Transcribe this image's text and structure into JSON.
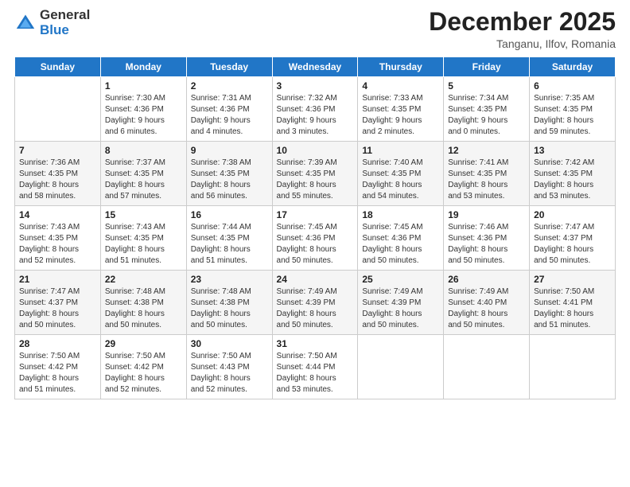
{
  "logo": {
    "general": "General",
    "blue": "Blue"
  },
  "header": {
    "month": "December 2025",
    "location": "Tanganu, Ilfov, Romania"
  },
  "days_of_week": [
    "Sunday",
    "Monday",
    "Tuesday",
    "Wednesday",
    "Thursday",
    "Friday",
    "Saturday"
  ],
  "weeks": [
    [
      {
        "day": "",
        "info": ""
      },
      {
        "day": "1",
        "info": "Sunrise: 7:30 AM\nSunset: 4:36 PM\nDaylight: 9 hours\nand 6 minutes."
      },
      {
        "day": "2",
        "info": "Sunrise: 7:31 AM\nSunset: 4:36 PM\nDaylight: 9 hours\nand 4 minutes."
      },
      {
        "day": "3",
        "info": "Sunrise: 7:32 AM\nSunset: 4:36 PM\nDaylight: 9 hours\nand 3 minutes."
      },
      {
        "day": "4",
        "info": "Sunrise: 7:33 AM\nSunset: 4:35 PM\nDaylight: 9 hours\nand 2 minutes."
      },
      {
        "day": "5",
        "info": "Sunrise: 7:34 AM\nSunset: 4:35 PM\nDaylight: 9 hours\nand 0 minutes."
      },
      {
        "day": "6",
        "info": "Sunrise: 7:35 AM\nSunset: 4:35 PM\nDaylight: 8 hours\nand 59 minutes."
      }
    ],
    [
      {
        "day": "7",
        "info": "Sunrise: 7:36 AM\nSunset: 4:35 PM\nDaylight: 8 hours\nand 58 minutes."
      },
      {
        "day": "8",
        "info": "Sunrise: 7:37 AM\nSunset: 4:35 PM\nDaylight: 8 hours\nand 57 minutes."
      },
      {
        "day": "9",
        "info": "Sunrise: 7:38 AM\nSunset: 4:35 PM\nDaylight: 8 hours\nand 56 minutes."
      },
      {
        "day": "10",
        "info": "Sunrise: 7:39 AM\nSunset: 4:35 PM\nDaylight: 8 hours\nand 55 minutes."
      },
      {
        "day": "11",
        "info": "Sunrise: 7:40 AM\nSunset: 4:35 PM\nDaylight: 8 hours\nand 54 minutes."
      },
      {
        "day": "12",
        "info": "Sunrise: 7:41 AM\nSunset: 4:35 PM\nDaylight: 8 hours\nand 53 minutes."
      },
      {
        "day": "13",
        "info": "Sunrise: 7:42 AM\nSunset: 4:35 PM\nDaylight: 8 hours\nand 53 minutes."
      }
    ],
    [
      {
        "day": "14",
        "info": "Sunrise: 7:43 AM\nSunset: 4:35 PM\nDaylight: 8 hours\nand 52 minutes."
      },
      {
        "day": "15",
        "info": "Sunrise: 7:43 AM\nSunset: 4:35 PM\nDaylight: 8 hours\nand 51 minutes."
      },
      {
        "day": "16",
        "info": "Sunrise: 7:44 AM\nSunset: 4:35 PM\nDaylight: 8 hours\nand 51 minutes."
      },
      {
        "day": "17",
        "info": "Sunrise: 7:45 AM\nSunset: 4:36 PM\nDaylight: 8 hours\nand 50 minutes."
      },
      {
        "day": "18",
        "info": "Sunrise: 7:45 AM\nSunset: 4:36 PM\nDaylight: 8 hours\nand 50 minutes."
      },
      {
        "day": "19",
        "info": "Sunrise: 7:46 AM\nSunset: 4:36 PM\nDaylight: 8 hours\nand 50 minutes."
      },
      {
        "day": "20",
        "info": "Sunrise: 7:47 AM\nSunset: 4:37 PM\nDaylight: 8 hours\nand 50 minutes."
      }
    ],
    [
      {
        "day": "21",
        "info": "Sunrise: 7:47 AM\nSunset: 4:37 PM\nDaylight: 8 hours\nand 50 minutes."
      },
      {
        "day": "22",
        "info": "Sunrise: 7:48 AM\nSunset: 4:38 PM\nDaylight: 8 hours\nand 50 minutes."
      },
      {
        "day": "23",
        "info": "Sunrise: 7:48 AM\nSunset: 4:38 PM\nDaylight: 8 hours\nand 50 minutes."
      },
      {
        "day": "24",
        "info": "Sunrise: 7:49 AM\nSunset: 4:39 PM\nDaylight: 8 hours\nand 50 minutes."
      },
      {
        "day": "25",
        "info": "Sunrise: 7:49 AM\nSunset: 4:39 PM\nDaylight: 8 hours\nand 50 minutes."
      },
      {
        "day": "26",
        "info": "Sunrise: 7:49 AM\nSunset: 4:40 PM\nDaylight: 8 hours\nand 50 minutes."
      },
      {
        "day": "27",
        "info": "Sunrise: 7:50 AM\nSunset: 4:41 PM\nDaylight: 8 hours\nand 51 minutes."
      }
    ],
    [
      {
        "day": "28",
        "info": "Sunrise: 7:50 AM\nSunset: 4:42 PM\nDaylight: 8 hours\nand 51 minutes."
      },
      {
        "day": "29",
        "info": "Sunrise: 7:50 AM\nSunset: 4:42 PM\nDaylight: 8 hours\nand 52 minutes."
      },
      {
        "day": "30",
        "info": "Sunrise: 7:50 AM\nSunset: 4:43 PM\nDaylight: 8 hours\nand 52 minutes."
      },
      {
        "day": "31",
        "info": "Sunrise: 7:50 AM\nSunset: 4:44 PM\nDaylight: 8 hours\nand 53 minutes."
      },
      {
        "day": "",
        "info": ""
      },
      {
        "day": "",
        "info": ""
      },
      {
        "day": "",
        "info": ""
      }
    ]
  ]
}
